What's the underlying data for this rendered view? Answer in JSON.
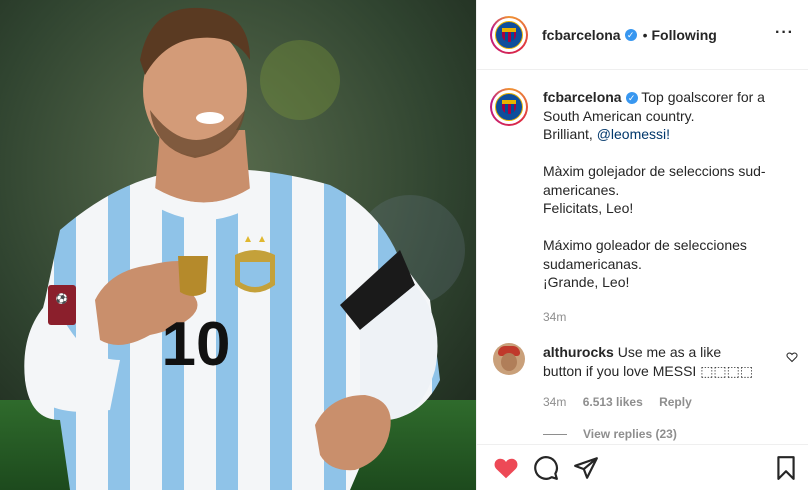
{
  "header": {
    "username": "fcbarcelona",
    "separator": "•",
    "follow_status": "Following",
    "more_label": "···"
  },
  "caption": {
    "username": "fcbarcelona",
    "line1": "Top goalscorer for a South American country.",
    "line2_prefix": "Brilliant, ",
    "mention": "@leomessi!",
    "para2_line1": "Màxim golejador de seleccions sud-americanes.",
    "para2_line2": "Felicitats, Leo!",
    "para3_line1": "Máximo goleador de selecciones sudamericanas.",
    "para3_line2": "¡Grande, Leo!",
    "time": "34m"
  },
  "comment": {
    "username": "althurocks",
    "text": "Use me as a like button if you love MESSI ⬚⬚⬚⬚",
    "time": "34m",
    "likes": "6.513 likes",
    "reply_label": "Reply"
  },
  "replies": {
    "label": "View replies (23)"
  },
  "colors": {
    "like_red": "#ed4956",
    "verified_blue": "#3897f0",
    "mention_blue": "#00376b",
    "meta_gray": "#8e8e8e"
  },
  "icons": [
    "verified-badge-icon",
    "more-options-icon",
    "heart-outline-icon",
    "heart-filled-icon",
    "comment-icon",
    "share-icon",
    "bookmark-icon"
  ],
  "photo": {
    "jersey_number": "10"
  }
}
